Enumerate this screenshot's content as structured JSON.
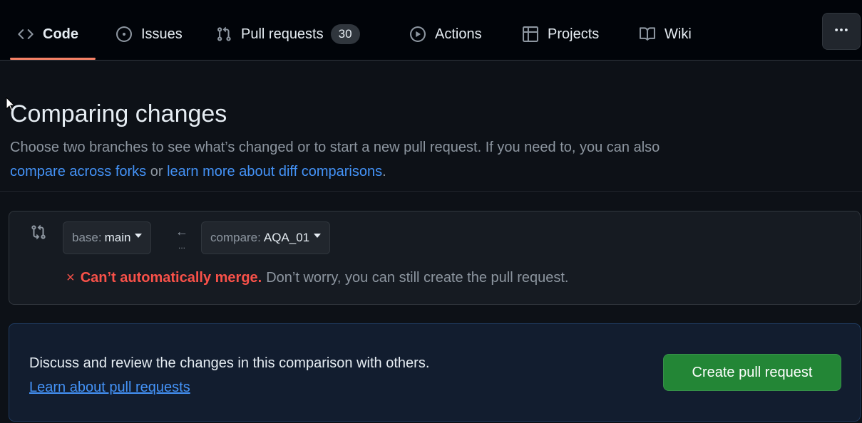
{
  "nav": {
    "tabs": [
      {
        "label": "Code",
        "icon": "code-icon",
        "active": true
      },
      {
        "label": "Issues",
        "icon": "issue-icon"
      },
      {
        "label": "Pull requests",
        "icon": "pull-request-icon",
        "count": "30"
      },
      {
        "label": "Actions",
        "icon": "play-icon"
      },
      {
        "label": "Projects",
        "icon": "table-icon"
      },
      {
        "label": "Wiki",
        "icon": "book-icon"
      }
    ],
    "more_icon": "kebab-horizontal-icon"
  },
  "header": {
    "title": "Comparing changes",
    "subtitle_text": "Choose two branches to see what’s changed or to start a new pull request. If you need to, you can also",
    "link_forks": "compare across forks",
    "or_text": " or ",
    "link_learn": "learn more about diff comparisons",
    "period": "."
  },
  "compare": {
    "base_prefix": "base:",
    "base_branch": "main",
    "arrow": "←",
    "ellipsis": "...",
    "compare_prefix": "compare:",
    "compare_branch": "AQA_01",
    "status_mark": "×",
    "status_strong": "Can’t automatically merge.",
    "status_text": "Don’t worry, you can still create the pull request."
  },
  "discuss": {
    "text": "Discuss and review the changes in this comparison with others.",
    "link": "Learn about pull requests",
    "button": "Create pull request"
  },
  "colors": {
    "background": "#0d1117",
    "nav_bg": "#010409",
    "accent_underline": "#f78166",
    "link": "#4493f8",
    "danger": "#f85149",
    "primary_button": "#238636",
    "discuss_bg": "#121d2f"
  }
}
